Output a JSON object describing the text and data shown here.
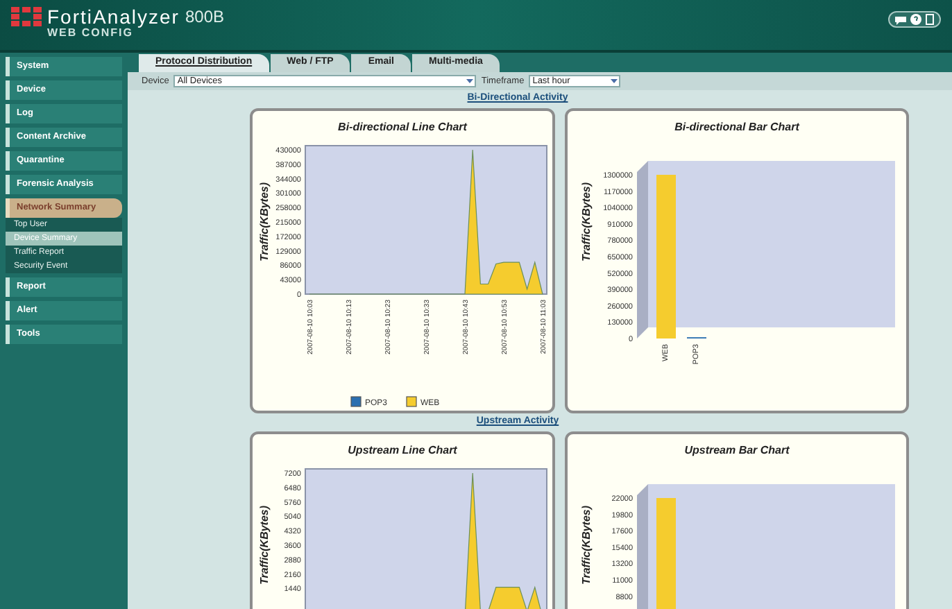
{
  "header": {
    "brand": "FortiAnalyzer",
    "model": "800B",
    "subtitle": "WEB CONFIG"
  },
  "sidebar": {
    "items": [
      {
        "label": "System",
        "expanded": false
      },
      {
        "label": "Device",
        "expanded": false
      },
      {
        "label": "Log",
        "expanded": false
      },
      {
        "label": "Content Archive",
        "expanded": false
      },
      {
        "label": "Quarantine",
        "expanded": false
      },
      {
        "label": "Forensic Analysis",
        "expanded": false
      },
      {
        "label": "Network Summary",
        "expanded": true,
        "children": [
          {
            "label": "Top User",
            "selected": false
          },
          {
            "label": "Device Summary",
            "selected": true
          },
          {
            "label": "Traffic Report",
            "selected": false
          },
          {
            "label": "Security Event",
            "selected": false
          }
        ]
      },
      {
        "label": "Report",
        "expanded": false
      },
      {
        "label": "Alert",
        "expanded": false
      },
      {
        "label": "Tools",
        "expanded": false
      }
    ]
  },
  "tabs": [
    {
      "label": "Protocol Distribution",
      "selected": true
    },
    {
      "label": "Web / FTP",
      "selected": false
    },
    {
      "label": "Email",
      "selected": false
    },
    {
      "label": "Multi-media",
      "selected": false
    }
  ],
  "filters": [
    {
      "label": "Device",
      "value": "All Devices"
    },
    {
      "label": "Timeframe",
      "value": "Last hour"
    }
  ],
  "sections": [
    {
      "title": "Bi-Directional Activity",
      "charts": [
        {
          "chart_data": {
            "type": "area",
            "title": "Bi-directional Line Chart",
            "ylabel": "Traffic(KBytes)",
            "categories": [
              "2007-08-10 10:03",
              null,
              null,
              null,
              null,
              "2007-08-10 10:13",
              null,
              null,
              null,
              null,
              "2007-08-10 10:23",
              null,
              null,
              null,
              null,
              "2007-08-10 10:33",
              null,
              null,
              null,
              null,
              "2007-08-10 10:43",
              null,
              null,
              null,
              null,
              "2007-08-10 10:53",
              null,
              null,
              null,
              null,
              "2007-08-10 11:03"
            ],
            "series": [
              {
                "color": "#f5cc2e",
                "values": [
                  0,
                  0,
                  0,
                  0,
                  0,
                  0,
                  0,
                  0,
                  0,
                  0,
                  0,
                  0,
                  0,
                  0,
                  0,
                  0,
                  0,
                  0,
                  0,
                  0,
                  0,
                  430000,
                  30000,
                  30000,
                  90000,
                  95000,
                  95000,
                  95000,
                  15000,
                  95000,
                  0
                ]
              }
            ],
            "ylim": [
              0,
              430000
            ],
            "yticks": [
              0,
              43000,
              86000,
              129000,
              172000,
              215000,
              258000,
              301000,
              344000,
              387000,
              430000
            ]
          },
          "legend": [
            {
              "name": "POP3",
              "color": "#2a6fb0"
            },
            {
              "name": "WEB",
              "color": "#f5cc2e"
            }
          ]
        },
        {
          "chart_data": {
            "type": "bar",
            "title": "Bi-directional Bar Chart",
            "ylabel": "Traffic(KBytes)",
            "categories": [
              "WEB",
              "POP3"
            ],
            "values": [
              1300000,
              10000
            ],
            "colors": [
              "#f5cc2e",
              "#2a6fb0"
            ],
            "ylim": [
              0,
              1300000
            ],
            "yticks": [
              0,
              130000,
              260000,
              390000,
              520000,
              650000,
              780000,
              910000,
              1040000,
              1170000,
              1300000
            ]
          }
        }
      ]
    },
    {
      "title": "Upstream Activity",
      "charts": [
        {
          "chart_data": {
            "type": "area",
            "title": "Upstream Line Chart",
            "ylabel": "Traffic(KBytes)",
            "categories": [
              null,
              null,
              null,
              null,
              null,
              null,
              null,
              null,
              null,
              null,
              null,
              null,
              null,
              null,
              null,
              null,
              null,
              null,
              null,
              null,
              null,
              null,
              null,
              null,
              null,
              null,
              null,
              null,
              null,
              null,
              null
            ],
            "series": [
              {
                "color": "#f5cc2e",
                "values": [
                  0,
                  0,
                  0,
                  0,
                  0,
                  0,
                  0,
                  0,
                  0,
                  0,
                  0,
                  0,
                  0,
                  0,
                  0,
                  0,
                  0,
                  0,
                  0,
                  0,
                  0,
                  7200,
                  300,
                  300,
                  1500,
                  1500,
                  1500,
                  1500,
                  300,
                  1500,
                  0
                ]
              }
            ],
            "ylim": [
              0,
              7200
            ],
            "yticks": [
              1440,
              2160,
              2880,
              3600,
              4320,
              5040,
              5760,
              6480,
              7200
            ]
          }
        },
        {
          "chart_data": {
            "type": "bar",
            "title": "Upstream Bar Chart",
            "ylabel": "Traffic(KBytes)",
            "categories": [
              null,
              null
            ],
            "values": [
              22000,
              200
            ],
            "colors": [
              "#f5cc2e",
              "#2a6fb0"
            ],
            "ylim": [
              0,
              22000
            ],
            "yticks": [
              8800,
              11000,
              13200,
              15400,
              17600,
              19800,
              22000
            ]
          }
        }
      ]
    }
  ]
}
